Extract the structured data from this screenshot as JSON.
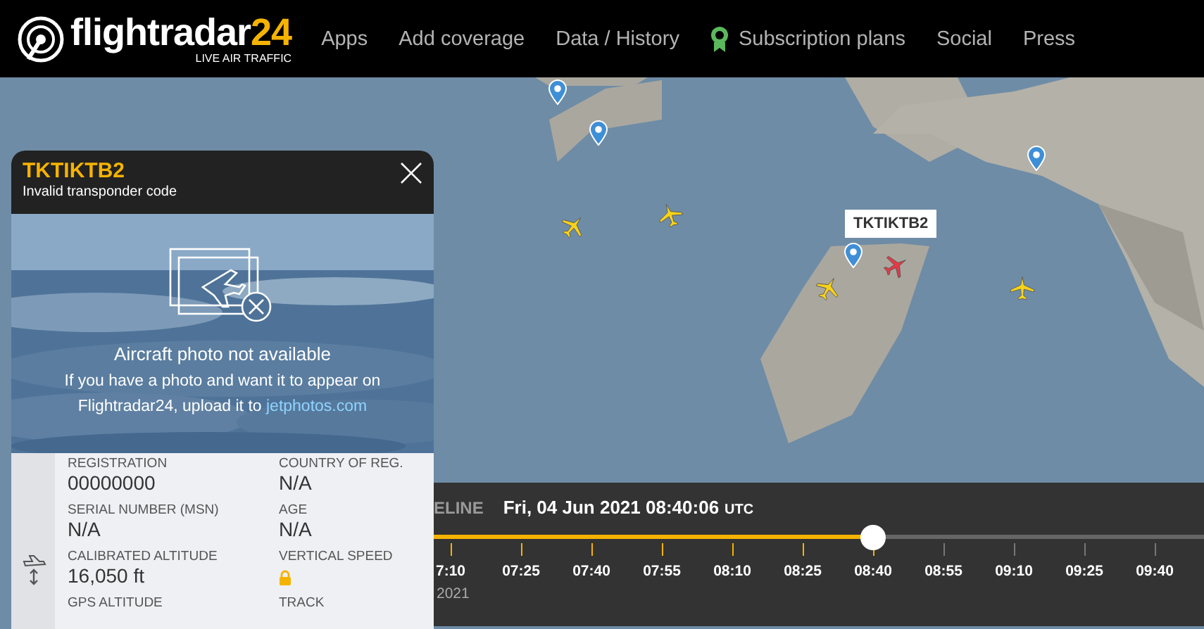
{
  "nav": {
    "logo": {
      "name": "flightradar",
      "number": "24",
      "tagline": "LIVE AIR TRAFFIC"
    },
    "items": [
      {
        "label": "Apps",
        "kind": "plain"
      },
      {
        "label": "Add coverage",
        "kind": "plain"
      },
      {
        "label": "Data / History",
        "kind": "plain"
      },
      {
        "label": "Subscription plans",
        "kind": "ribbon"
      },
      {
        "label": "Social",
        "kind": "plain"
      },
      {
        "label": "Press",
        "kind": "plain"
      }
    ]
  },
  "map": {
    "callsign_label": "TKTIKTB2",
    "aircraft": [
      {
        "selected": false
      },
      {
        "selected": false
      },
      {
        "selected": false
      },
      {
        "selected": true
      },
      {
        "selected": false
      }
    ]
  },
  "panel": {
    "callsign": "TKTIKTB2",
    "subtitle": "Invalid transponder code",
    "photo": {
      "kind": "picture",
      "title": "Aircraft photo not available",
      "text": "If you have a photo and want it to appear on Flightradar24, upload it to",
      "link": "jetphotos.com"
    },
    "details": [
      {
        "label": "REGISTRATION",
        "value": "00000000",
        "kind": "text"
      },
      {
        "label": "COUNTRY OF REG.",
        "value": "N/A",
        "kind": "text"
      },
      {
        "label": "SERIAL NUMBER (MSN)",
        "value": "N/A",
        "kind": "text"
      },
      {
        "label": "AGE",
        "value": "N/A",
        "kind": "text"
      },
      {
        "label": "CALIBRATED ALTITUDE",
        "value": "16,050 ft",
        "kind": "text"
      },
      {
        "label": "VERTICAL SPEED",
        "kind": "locked"
      },
      {
        "label": "GPS ALTITUDE",
        "kind": "cut"
      },
      {
        "label": "TRACK",
        "kind": "cut"
      }
    ]
  },
  "timeline": {
    "title": "ELINE",
    "date": "Fri, 04 Jun 2021 08:40:06",
    "timezone": "UTC",
    "level": 0.571,
    "year": "2021",
    "ticks": [
      {
        "label": "7:10",
        "passed": true
      },
      {
        "label": "07:25",
        "passed": true
      },
      {
        "label": "07:40",
        "passed": true
      },
      {
        "label": "07:55",
        "passed": true
      },
      {
        "label": "08:10",
        "passed": true
      },
      {
        "label": "08:25",
        "passed": true
      },
      {
        "label": "08:40",
        "passed": true
      },
      {
        "label": "08:55",
        "passed": false
      },
      {
        "label": "09:10",
        "passed": false
      },
      {
        "label": "09:25",
        "passed": false
      },
      {
        "label": "09:40",
        "passed": false
      }
    ]
  }
}
